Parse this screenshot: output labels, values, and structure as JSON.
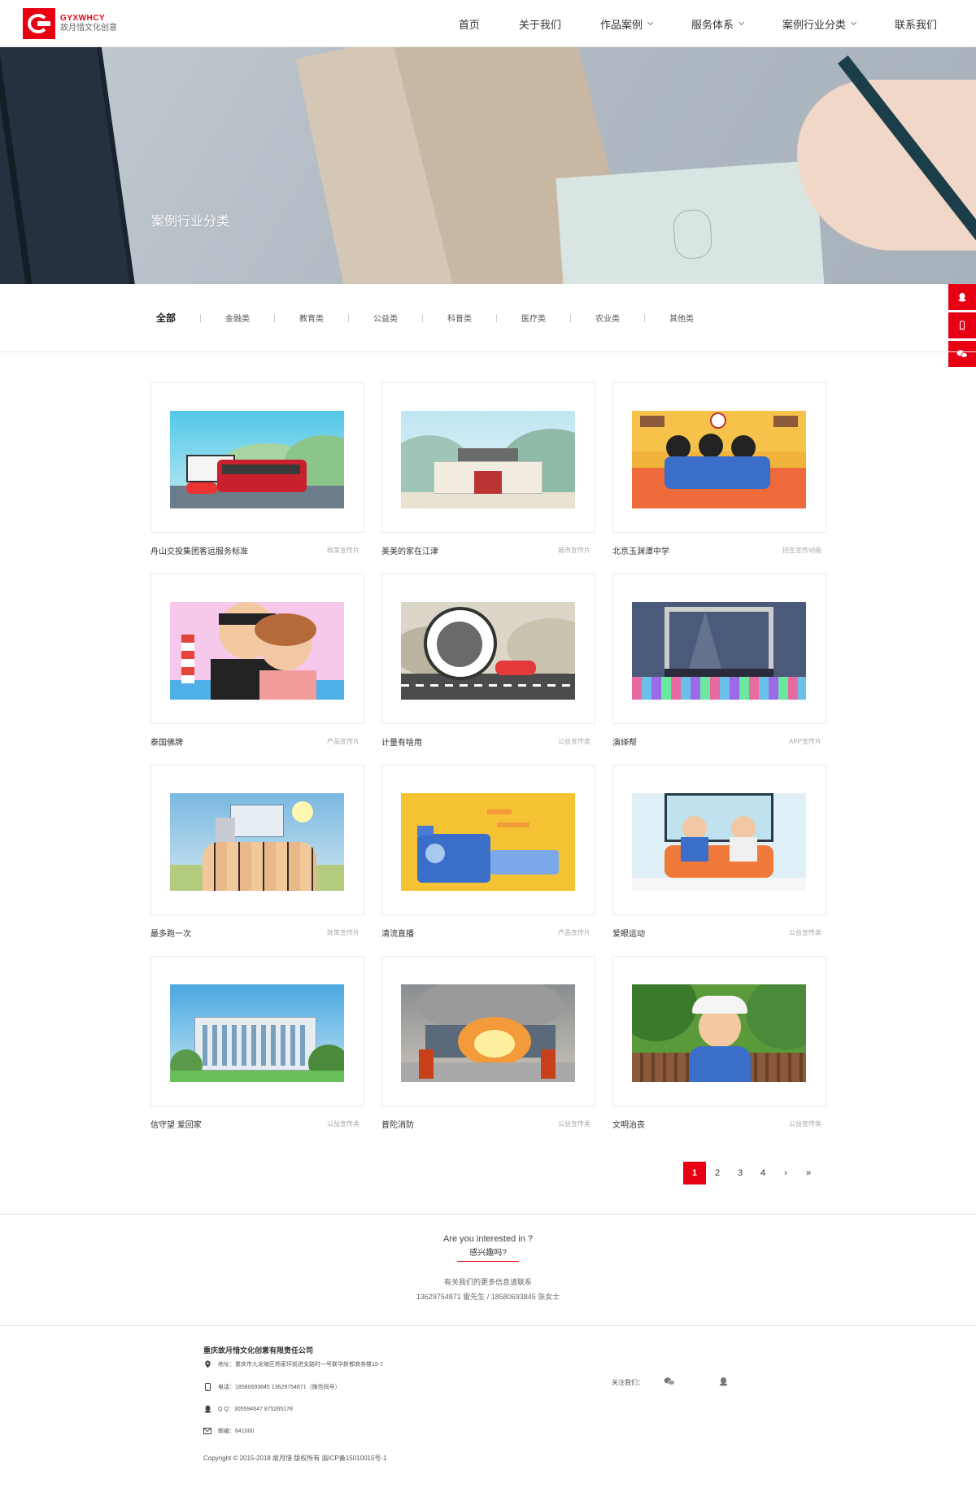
{
  "header": {
    "logo_en": "GYXWHCY",
    "logo_cn": "故月惜文化创意",
    "nav": [
      {
        "label": "首页",
        "dropdown": false
      },
      {
        "label": "关于我们",
        "dropdown": false
      },
      {
        "label": "作品案例",
        "dropdown": true
      },
      {
        "label": "服务体系",
        "dropdown": true
      },
      {
        "label": "案例行业分类",
        "dropdown": true
      },
      {
        "label": "联系我们",
        "dropdown": false
      }
    ]
  },
  "banner": {
    "title": "案例行业分类"
  },
  "side_float": {
    "icons": [
      "qq-icon",
      "phone-icon",
      "wechat-icon"
    ]
  },
  "filter": {
    "items": [
      "全部",
      "金融类",
      "教育类",
      "公益类",
      "科普类",
      "医疗类",
      "农业类",
      "其他类"
    ],
    "active": "全部"
  },
  "cases": [
    {
      "name": "舟山交投集团客运服务标准",
      "tag": "政策宣传片"
    },
    {
      "name": "美美的家在江津",
      "tag": "城市宣传片"
    },
    {
      "name": "北京玉渊潭中学",
      "tag": "招生宣传动画"
    },
    {
      "name": "泰国佛牌",
      "tag": "产品宣传片"
    },
    {
      "name": "计量有啥用",
      "tag": "公益宣传类"
    },
    {
      "name": "演绎帮",
      "tag": "APP宣传片"
    },
    {
      "name": "最多跑一次",
      "tag": "政策宣传片"
    },
    {
      "name": "清流直播",
      "tag": "产品宣传片"
    },
    {
      "name": "爱眼运动",
      "tag": "公益宣传类"
    },
    {
      "name": "信守望 爱回家",
      "tag": "公益宣传类"
    },
    {
      "name": "普陀消防",
      "tag": "公益宣传类"
    },
    {
      "name": "文明治丧",
      "tag": "公益宣传类"
    }
  ],
  "pagination": {
    "pages": [
      "1",
      "2",
      "3",
      "4",
      "›",
      "»"
    ],
    "current": "1"
  },
  "interest": {
    "en": "Are you interested in ?",
    "cn": "感兴趣吗?",
    "info1": "有关我们的更多信息请联系",
    "info2": "13629754871 雷先生 / 18580693845 张女士"
  },
  "footer": {
    "company": "重庆故月惜文化创意有限责任公司",
    "address": "地址：重庆市九龙坡区杨家坪前进支路时一号联华新都商务楼15-7",
    "phone": "电话：18580693845  13629754871（微信同号）",
    "qq": "Q Q：305594647   875265178",
    "email": "邮编：641000",
    "copyright": "Copyright © 2015-2018 故月惜 版权所有   渝ICP备15010015号-1",
    "follow_label": "关注我们："
  }
}
